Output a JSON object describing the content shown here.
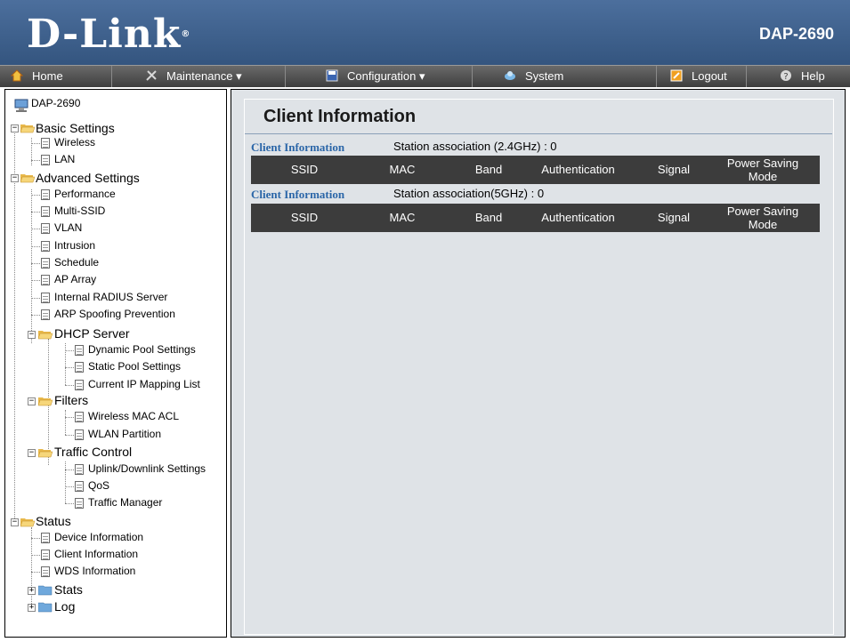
{
  "header": {
    "brand": "D-Link",
    "model": "DAP-2690"
  },
  "menu": {
    "items": [
      {
        "label": "Home",
        "icon": "home-icon"
      },
      {
        "label": "Maintenance",
        "icon": "tools-icon",
        "dropdown": true
      },
      {
        "label": "Configuration",
        "icon": "save-disk-icon",
        "dropdown": true
      },
      {
        "label": "System",
        "icon": "system-icon"
      },
      {
        "label": "Logout",
        "icon": "logout-icon"
      },
      {
        "label": "Help",
        "icon": "help-icon"
      }
    ]
  },
  "tree": {
    "root": "DAP-2690",
    "basic": "Basic Settings",
    "wireless": "Wireless",
    "lan": "LAN",
    "advanced": "Advanced Settings",
    "performance": "Performance",
    "multissid": "Multi-SSID",
    "vlan": "VLAN",
    "intrusion": "Intrusion",
    "schedule": "Schedule",
    "aparray": "AP Array",
    "radius": "Internal RADIUS Server",
    "arp": "ARP Spoofing Prevention",
    "dhcp": "DHCP Server",
    "dynamic": "Dynamic Pool Settings",
    "static": "Static Pool Settings",
    "ipmap": "Current IP Mapping List",
    "filters": "Filters",
    "macacl": "Wireless MAC ACL",
    "wlanpart": "WLAN Partition",
    "traffic": "Traffic Control",
    "uplink": "Uplink/Downlink Settings",
    "qos": "QoS",
    "trafficmgr": "Traffic Manager",
    "status": "Status",
    "devinfo": "Device Information",
    "clientinfo": "Client Information",
    "wdsinfo": "WDS Information",
    "stats": "Stats",
    "log": "Log"
  },
  "content": {
    "title": "Client Information",
    "section1": {
      "label": "Client Information",
      "status": "Station association (2.4GHz) : 0"
    },
    "section2": {
      "label": "Client Information",
      "status": "Station association(5GHz) : 0"
    },
    "columns": {
      "ssid": "SSID",
      "mac": "MAC",
      "band": "Band",
      "auth": "Authentication",
      "signal": "Signal",
      "psm1": "Power Saving",
      "psm2": "Mode"
    }
  }
}
